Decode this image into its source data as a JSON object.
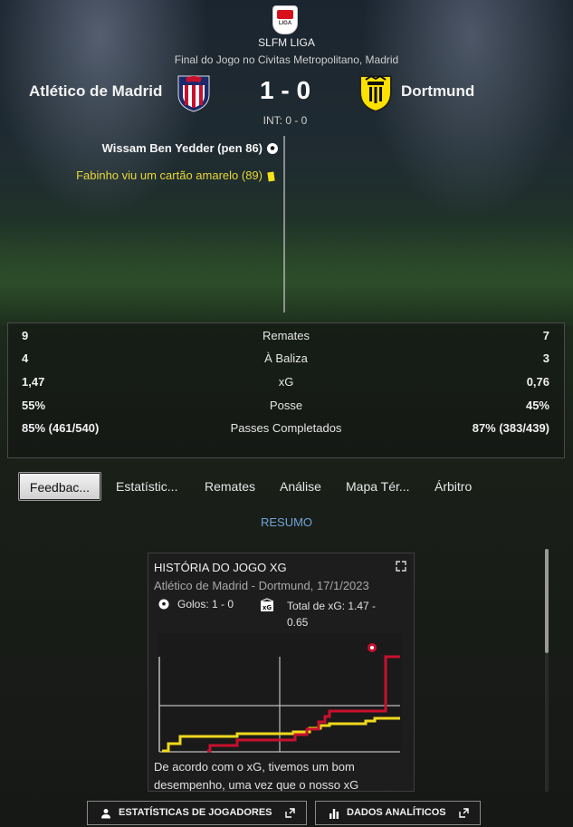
{
  "header": {
    "league_logo_text": "LIGA",
    "league_name": "SLFM LIGA",
    "venue": "Final do Jogo no Civitas Metropolitano, Madrid",
    "home_team": "Atlético de Madrid",
    "away_team": "Dortmund",
    "score": "1 - 0",
    "half_time": "INT: 0 - 0",
    "home_color": "#c8102e",
    "away_color": "#fde100"
  },
  "events": {
    "goal": "Wissam Ben Yedder (pen 86)",
    "yellow_card": "Fabinho viu um cartão amarelo (89)"
  },
  "stats": [
    {
      "home": "9",
      "label": "Remates",
      "away": "7"
    },
    {
      "home": "4",
      "label": "À Baliza",
      "away": "3"
    },
    {
      "home": "1,47",
      "label": "xG",
      "away": "0,76"
    },
    {
      "home": "55%",
      "label": "Posse",
      "away": "45%"
    },
    {
      "home": "85% (461/540)",
      "label": "Passes Completados",
      "away": "87% (383/439)"
    }
  ],
  "tabs": [
    "Feedbac...",
    "Estatístic...",
    "Remates",
    "Análise",
    "Mapa Tér...",
    "Árbitro"
  ],
  "summary_label": "RESUMO",
  "xg_card": {
    "title": "HISTÓRIA DO JOGO XG",
    "subtitle": "Atlético de Madrid - Dortmund, 17/1/2023",
    "goals_text": "Golos: 1 - 0",
    "xg_text": "Total de xG: 1.47 - 0.65",
    "description": "De acordo com o xG, tivemos um bom desempenho, uma vez que o nosso xG"
  },
  "buttons": {
    "players": "ESTATÍSTICAS DE JOGADORES",
    "data": "DADOS ANALÍTICOS"
  },
  "colors": {
    "link": "#6fa3d8",
    "card_yellow": "#f4e21c",
    "home_line": "#c8102e",
    "away_line": "#f0d81c"
  }
}
